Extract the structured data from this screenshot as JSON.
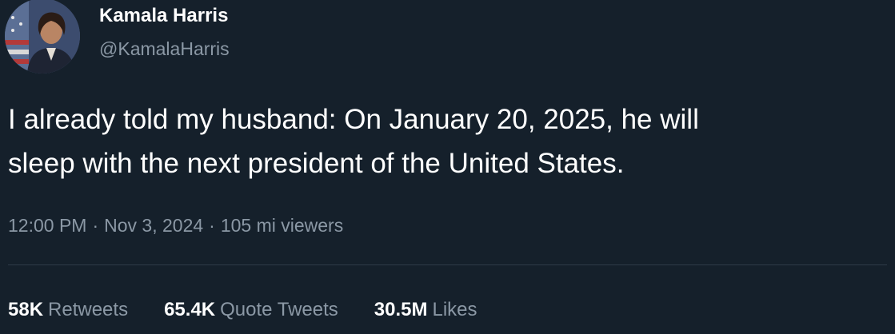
{
  "tweet": {
    "author": {
      "display_name": "Kamala Harris",
      "handle": "@KamalaHarris",
      "avatar_icon": "profile-photo"
    },
    "text_line1": "I already told my husband: On January 20, 2025, he will",
    "text_line2": "sleep with the next president of the United States.",
    "meta": {
      "time": "12:00 PM",
      "date": "Nov 3, 2024",
      "views": "105 mi viewers",
      "separator": "·"
    },
    "stats": {
      "retweets_count": "58K",
      "retweets_label": "Retweets",
      "quotes_count": "65.4K",
      "quotes_label": "Quote Tweets",
      "likes_count": "30.5M",
      "likes_label": "Likes"
    }
  },
  "colors": {
    "background": "#15202b",
    "primary_text": "#ffffff",
    "secondary_text": "#8b98a5",
    "divider": "#2f3b47"
  }
}
